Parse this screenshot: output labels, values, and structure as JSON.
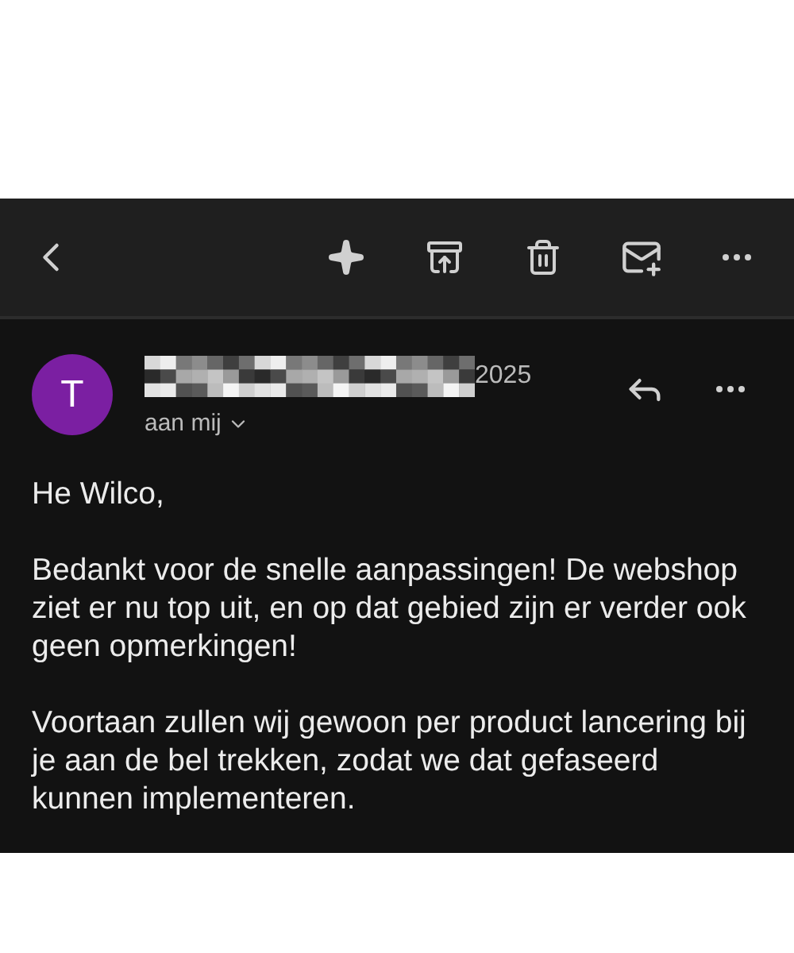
{
  "sender": {
    "avatar_letter": "T",
    "date": "2025",
    "recipient": "aan mij"
  },
  "body": [
    "He Wilco,",
    "Bedankt voor de snelle aanpassingen! De webshop ziet er nu top uit, en op dat gebied zijn er verder ook geen opmerkingen!",
    "Voortaan zullen wij gewoon per product lancering bij je aan de bel trekken, zodat we dat gefaseerd kunnen implementeren."
  ]
}
